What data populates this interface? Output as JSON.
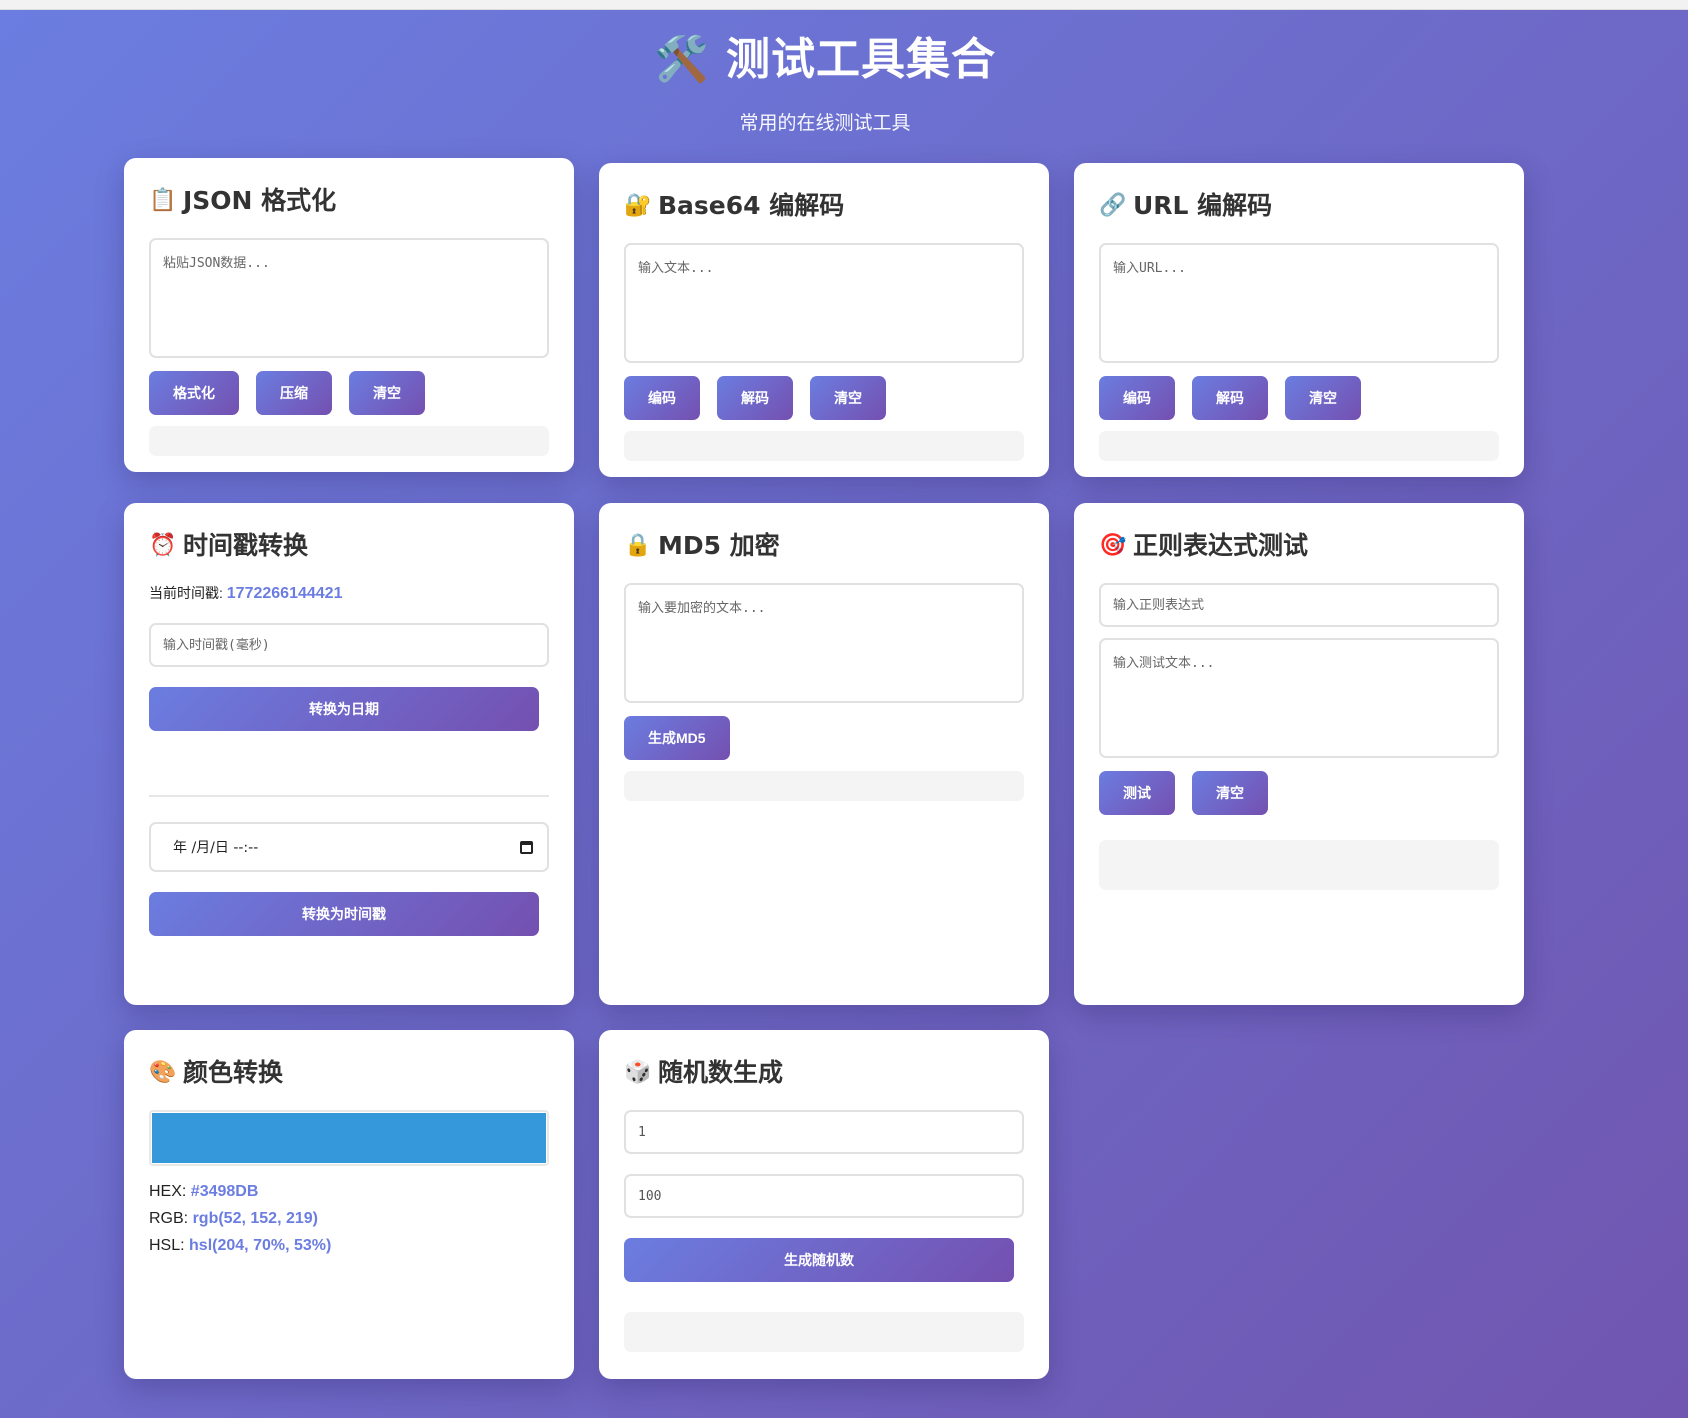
{
  "header": {
    "icon": "hammer-wrench-icon",
    "title": "🛠️ 测试工具集合",
    "subtitle": "常用的在线测试工具"
  },
  "json_tool": {
    "icon": "clipboard-icon",
    "icon_glyph": "📋",
    "title": "JSON 格式化",
    "placeholder": "粘贴JSON数据...",
    "buttons": {
      "format": "格式化",
      "compress": "压缩",
      "clear": "清空"
    }
  },
  "base64_tool": {
    "icon": "lock-key-icon",
    "icon_glyph": "🔐",
    "title": "Base64 编解码",
    "placeholder": "输入文本...",
    "buttons": {
      "encode": "编码",
      "decode": "解码",
      "clear": "清空"
    }
  },
  "url_tool": {
    "icon": "link-icon",
    "icon_glyph": "🔗",
    "title": "URL 编解码",
    "placeholder": "输入URL...",
    "buttons": {
      "encode": "编码",
      "decode": "解码",
      "clear": "清空"
    }
  },
  "timestamp_tool": {
    "icon": "alarm-clock-icon",
    "icon_glyph": "⏰",
    "title": "时间戳转换",
    "current_label": "当前时间戳:",
    "current_value": "1772266144421",
    "input_placeholder": "输入时间戳(毫秒)",
    "to_date_button": "转换为日期",
    "datetime_display": "年 /月/日 --:--",
    "to_timestamp_button": "转换为时间戳"
  },
  "md5_tool": {
    "icon": "lock-icon",
    "icon_glyph": "🔒",
    "title": "MD5 加密",
    "placeholder": "输入要加密的文本...",
    "button": "生成MD5"
  },
  "regex_tool": {
    "icon": "target-icon",
    "icon_glyph": "🎯",
    "title": "正则表达式测试",
    "pattern_placeholder": "输入正则表达式",
    "text_placeholder": "输入测试文本...",
    "buttons": {
      "test": "测试",
      "clear": "清空"
    }
  },
  "color_tool": {
    "icon": "palette-icon",
    "icon_glyph": "🎨",
    "title": "颜色转换",
    "swatch_color": "#3498DB",
    "hex_label": "HEX:",
    "hex_value": "#3498DB",
    "rgb_label": "RGB:",
    "rgb_value": "rgb(52, 152, 219)",
    "hsl_label": "HSL:",
    "hsl_value": "hsl(204, 70%, 53%)"
  },
  "random_tool": {
    "icon": "dice-icon",
    "icon_glyph": "🎲",
    "title": "随机数生成",
    "min_value": "1",
    "max_value": "100",
    "button": "生成随机数"
  },
  "colors": {
    "accent": "#6b7de0",
    "accent_end": "#7450b0",
    "card_bg": "#ffffff",
    "result_bg": "#f4f4f4"
  }
}
